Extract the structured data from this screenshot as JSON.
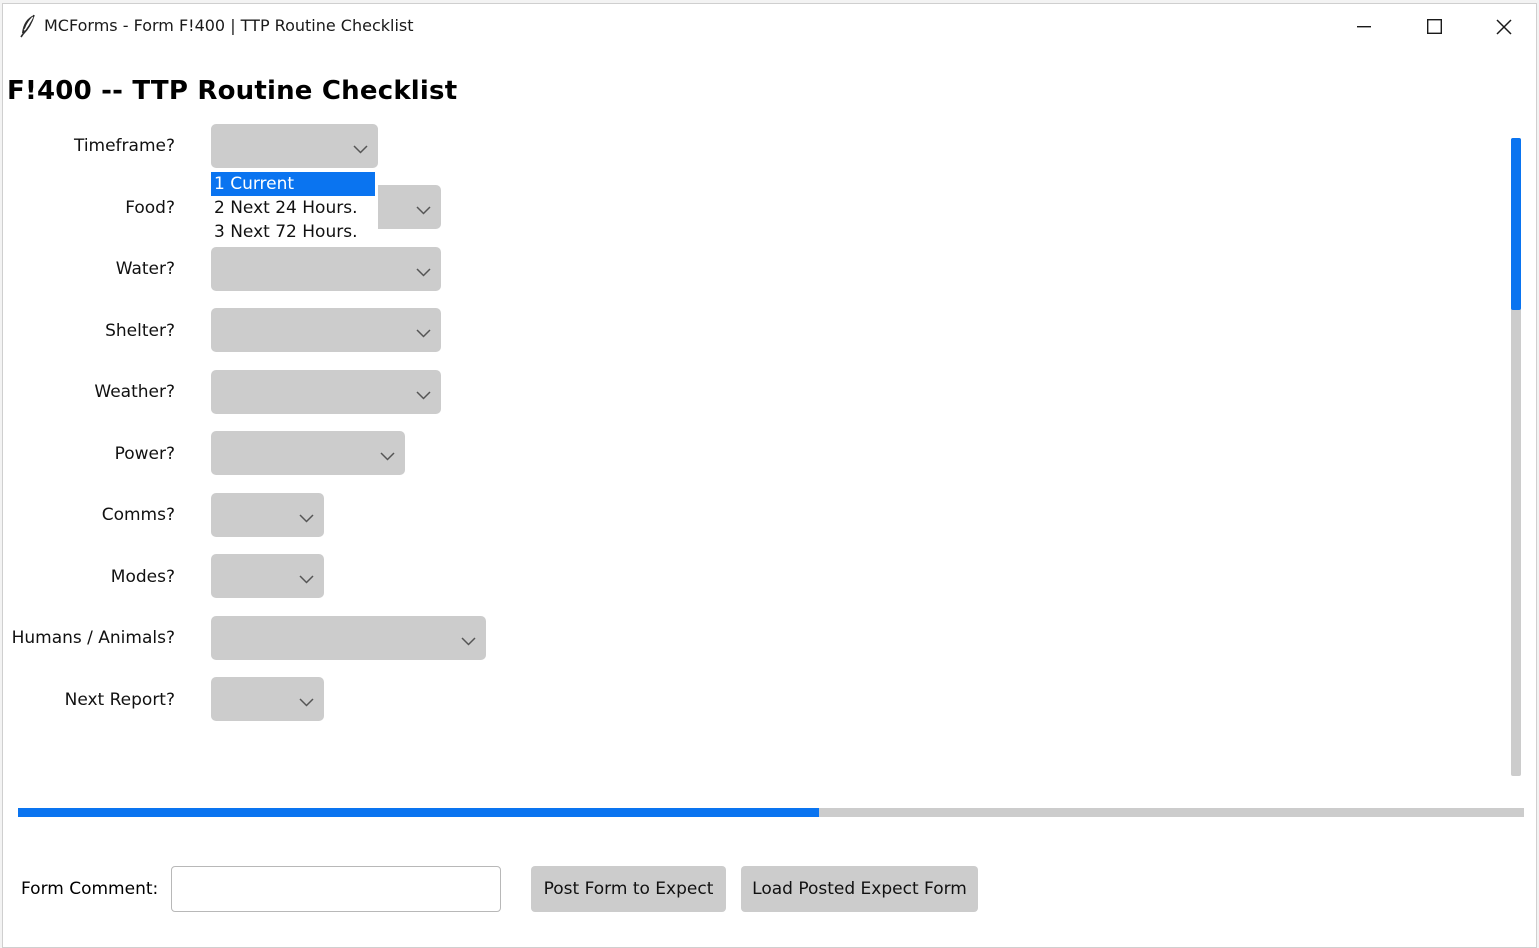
{
  "window": {
    "title": "MCForms - Form F!400 | TTP Routine Checklist",
    "icon": "feather-icon",
    "controls": [
      "minimize-icon",
      "maximize-icon",
      "close-icon"
    ]
  },
  "form": {
    "heading": "F!400 -- TTP Routine Checklist",
    "fields": [
      {
        "label": "Timeframe?",
        "value": ""
      },
      {
        "label": "Food?",
        "value": ""
      },
      {
        "label": "Water?",
        "value": ""
      },
      {
        "label": "Shelter?",
        "value": ""
      },
      {
        "label": "Weather?",
        "value": ""
      },
      {
        "label": "Power?",
        "value": ""
      },
      {
        "label": "Comms?",
        "value": ""
      },
      {
        "label": "Modes?",
        "value": ""
      },
      {
        "label": "Humans / Animals?",
        "value": ""
      },
      {
        "label": "Next Report?",
        "value": ""
      }
    ],
    "open_dropdown": {
      "field": "Timeframe?",
      "options": [
        "1 Current",
        "2 Next 24 Hours.",
        "3 Next 72 Hours."
      ],
      "highlighted": "1 Current"
    }
  },
  "progress": {
    "fraction": 0.532
  },
  "vertical_scroll": {
    "visible_fraction": 0.27
  },
  "footer": {
    "comment_label": "Form Comment:",
    "comment_value": "",
    "post_button": "Post Form to Expect",
    "load_button": "Load Posted Expect Form"
  },
  "colors": {
    "accent": "#0a74f0",
    "control_bg": "#cccccc"
  }
}
